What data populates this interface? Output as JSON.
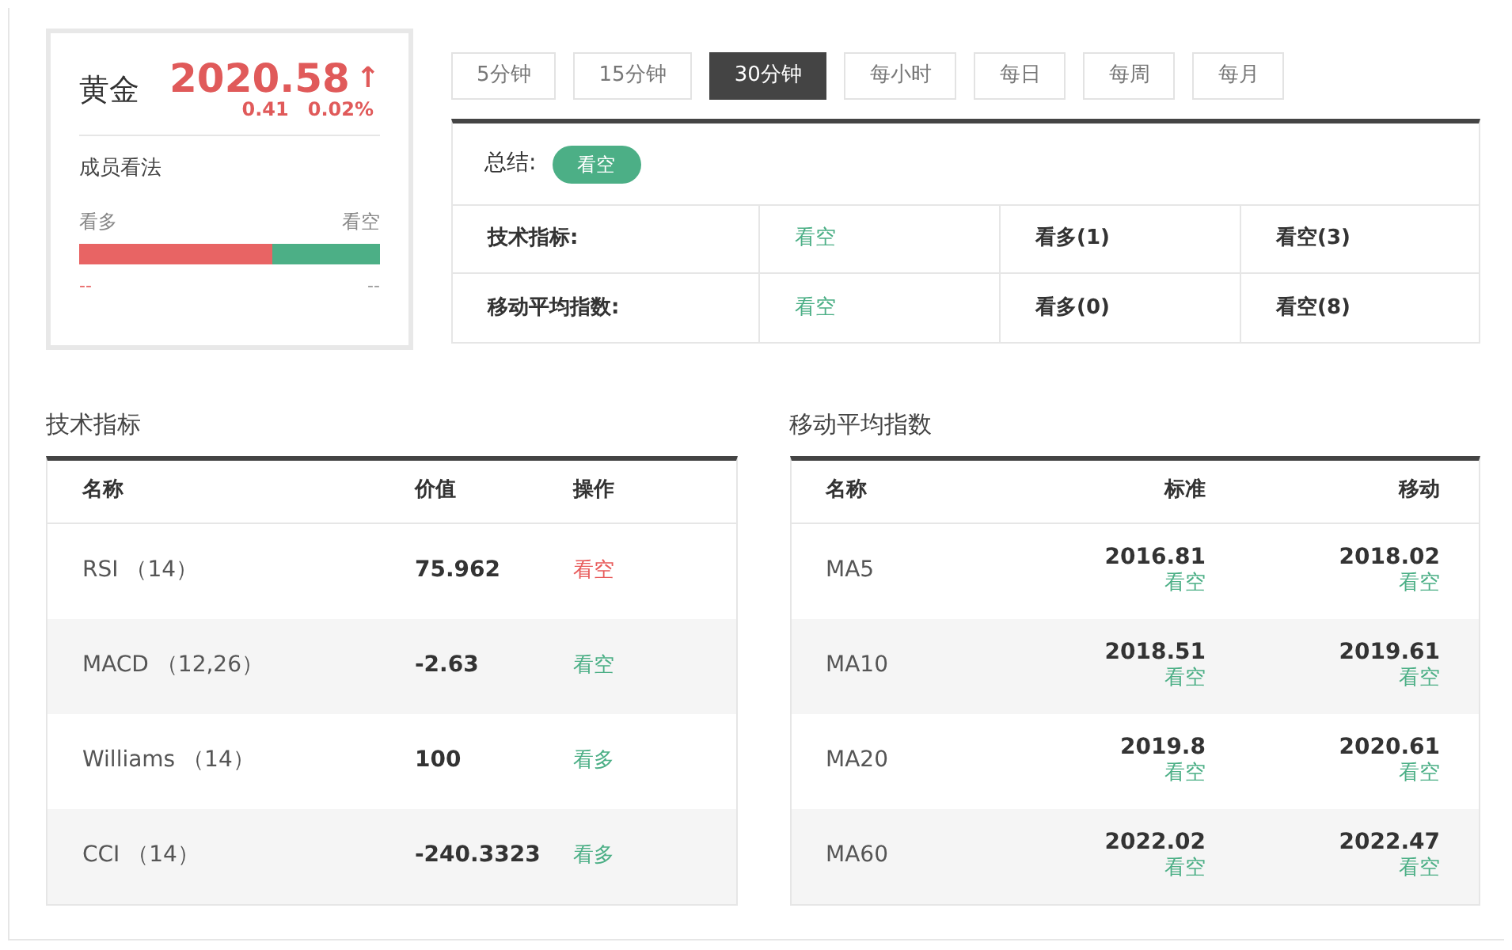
{
  "quote": {
    "name": "黄金",
    "price": "2020.58",
    "arrow": "↑",
    "change": "0.41",
    "change_pct": "0.02%",
    "opinion": {
      "title": "成员看法",
      "bull_label": "看多",
      "bear_label": "看空",
      "level": 0.64,
      "bull_value": "--",
      "bear_value": "--"
    }
  },
  "periods": [
    {
      "label": "5分钟",
      "selected": false
    },
    {
      "label": "15分钟",
      "selected": false
    },
    {
      "label": "30分钟",
      "selected": true
    },
    {
      "label": "每小时",
      "selected": false
    },
    {
      "label": "每日",
      "selected": false
    },
    {
      "label": "每周",
      "selected": false
    },
    {
      "label": "每月",
      "selected": false
    }
  ],
  "summary": {
    "label": "总结:",
    "badge": {
      "text": "看空",
      "color": "#4caf86"
    },
    "rows": [
      {
        "name": "技术指标:",
        "signal": "看空",
        "color": "#4caf86",
        "bull": "看多(1)",
        "bear": "看空(3)"
      },
      {
        "name": "移动平均指数:",
        "signal": "看空",
        "color": "#4caf86",
        "bull": "看多(0)",
        "bear": "看空(8)"
      }
    ]
  },
  "technical": {
    "title": "技术指标",
    "columns": [
      "名称",
      "价值",
      "操作"
    ],
    "rows": [
      {
        "name": "RSI （14）",
        "value": "75.962",
        "action": "看空",
        "color": "#e85c5c"
      },
      {
        "name": "MACD （12,26）",
        "value": "-2.63",
        "action": "看空",
        "color": "#4caf86"
      },
      {
        "name": "Williams （14）",
        "value": "100",
        "action": "看多",
        "color": "#4caf86"
      },
      {
        "name": "CCI （14）",
        "value": "-240.3323",
        "action": "看多",
        "color": "#4caf86"
      }
    ]
  },
  "moving_averages": {
    "title": "移动平均指数",
    "columns": [
      "名称",
      "标准",
      "移动"
    ],
    "rows": [
      {
        "name": "MA5",
        "simple": {
          "value": "2016.81",
          "signal": "看空",
          "color": "#4caf86"
        },
        "moving": {
          "value": "2018.02",
          "signal": "看空",
          "color": "#4caf86"
        }
      },
      {
        "name": "MA10",
        "simple": {
          "value": "2018.51",
          "signal": "看空",
          "color": "#4caf86"
        },
        "moving": {
          "value": "2019.61",
          "signal": "看空",
          "color": "#4caf86"
        }
      },
      {
        "name": "MA20",
        "simple": {
          "value": "2019.8",
          "signal": "看空",
          "color": "#4caf86"
        },
        "moving": {
          "value": "2020.61",
          "signal": "看空",
          "color": "#4caf86"
        }
      },
      {
        "name": "MA60",
        "simple": {
          "value": "2022.02",
          "signal": "看空",
          "color": "#4caf86"
        },
        "moving": {
          "value": "2022.47",
          "signal": "看空",
          "color": "#4caf86"
        }
      }
    ]
  }
}
